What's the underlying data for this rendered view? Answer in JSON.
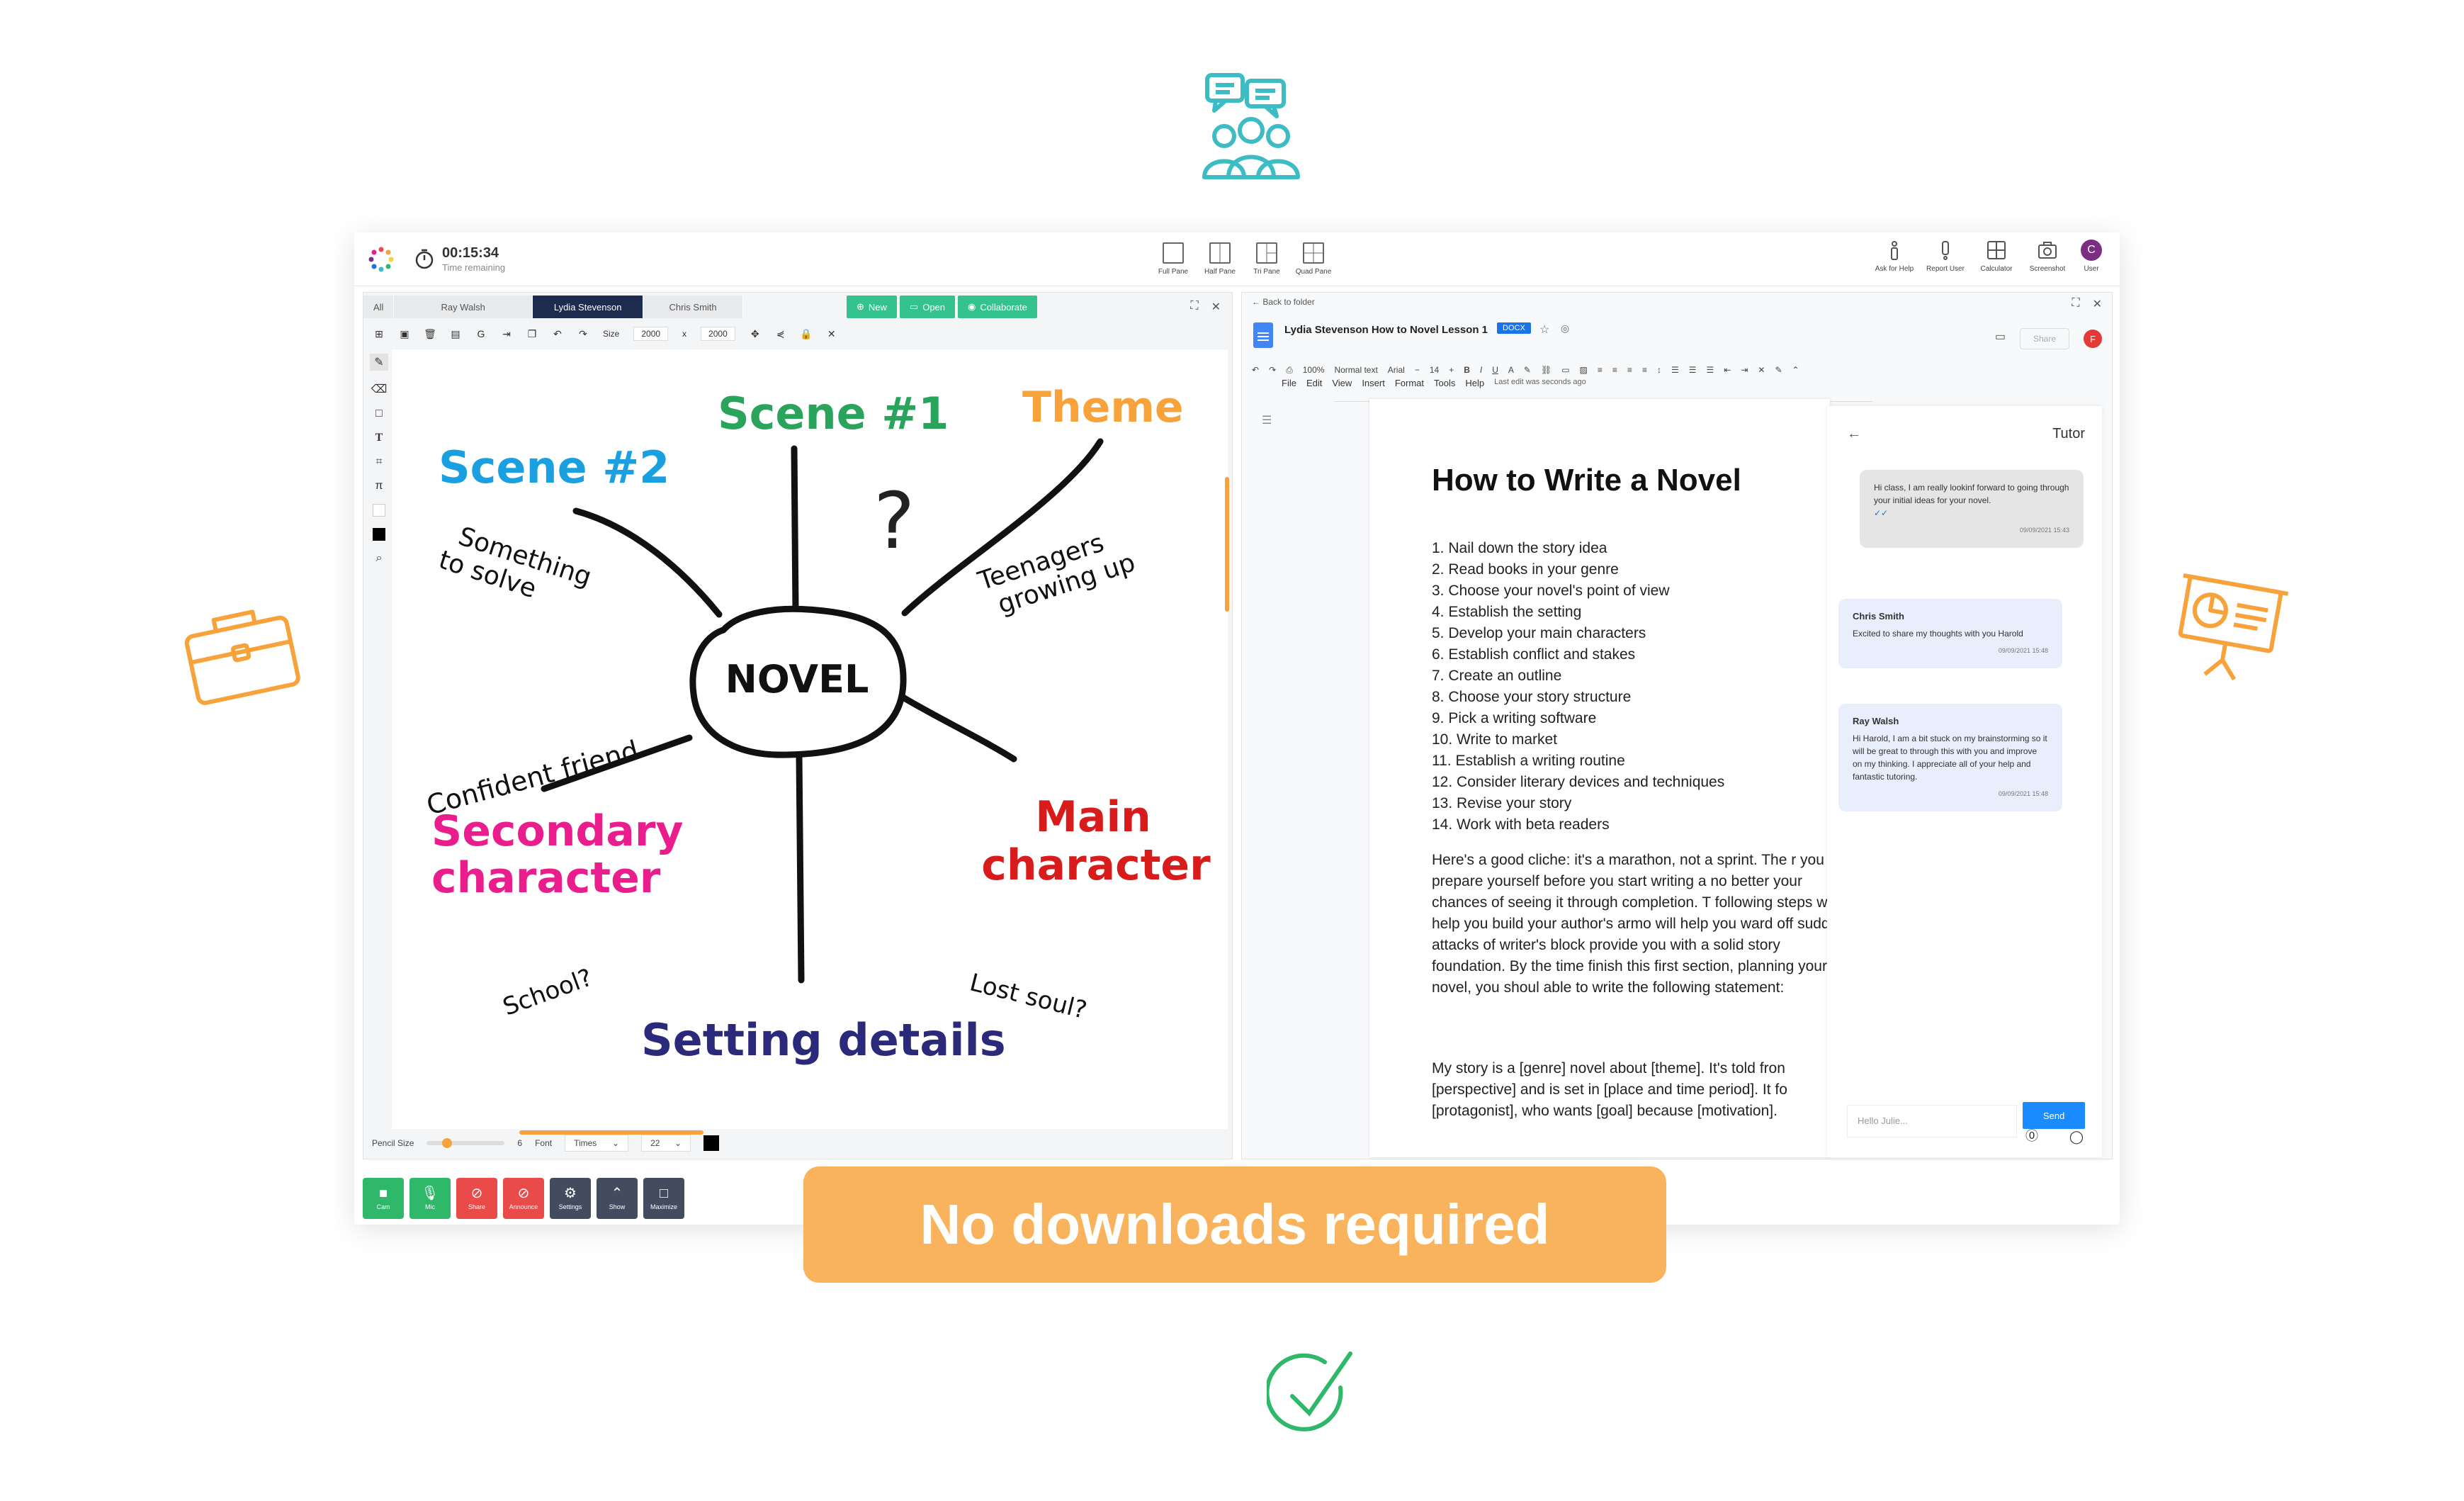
{
  "topbar": {
    "timer_value": "00:15:34",
    "timer_label": "Time remaining",
    "panes": [
      "Full Pane",
      "Half Pane",
      "Tri Pane",
      "Quad Pane"
    ],
    "tools": [
      "Ask for Help",
      "Report User",
      "Calculator",
      "Screenshot",
      "User"
    ],
    "avatar_letter": "C"
  },
  "whiteboard": {
    "tabs": [
      "All",
      "Ray Walsh",
      "Lydia Stevenson",
      "Chris Smith"
    ],
    "actions": [
      "New",
      "Open",
      "Collaborate"
    ],
    "size_label": "Size",
    "size_w": "2000",
    "size_x": "x",
    "size_h": "2000",
    "mindmap": {
      "center": "NOVEL",
      "scene1": "Scene #1",
      "scene2": "Scene #2",
      "theme": "Theme",
      "question": "?",
      "something": [
        "Something",
        "to solve"
      ],
      "teenagers": [
        "Teenagers",
        "growing up"
      ],
      "confident": "Confident friend",
      "secondary": [
        "Secondary",
        "character"
      ],
      "main": [
        "Main",
        "character"
      ],
      "school": "School?",
      "lostsoul": "Lost soul?",
      "setting": "Setting details"
    },
    "pencil_label": "Pencil Size",
    "pencil_value": "6",
    "font_label": "Font",
    "font_value": "Times",
    "font_size": "22"
  },
  "controls": [
    "Cam",
    "Mic",
    "Share",
    "Announce",
    "Settings",
    "Show",
    "Maximize"
  ],
  "doc": {
    "back": "Back to folder",
    "title": "Lydia Stevenson How to Novel Lesson 1",
    "badge": "DOCX",
    "menu": [
      "File",
      "Edit",
      "View",
      "Insert",
      "Format",
      "Tools",
      "Help"
    ],
    "last_edit": "Last edit was seconds ago",
    "zoom": "100%",
    "style": "Normal text",
    "font": "Arial",
    "font_size": "14",
    "share": "Share",
    "fav": "F",
    "heading": "How to Write a Novel",
    "list": [
      "1. Nail down the story idea",
      "2. Read books in your genre",
      "3. Choose your novel's point of view",
      "4. Establish the setting",
      "5. Develop your main characters",
      "6. Establish conflict and stakes",
      "7. Create an outline",
      "8. Choose your story structure",
      "9. Pick a writing software",
      "10. Write to market",
      "11. Establish a writing routine",
      "12. Consider literary devices and techniques",
      "13. Revise your story",
      "14. Work with beta readers"
    ],
    "para1": "Here's a good cliche: it's a marathon, not a sprint. The r you can prepare yourself before you start writing a no better your chances of seeing it through completion. T following steps will help you build your author's armo will help you ward off sudden attacks of writer's block provide you with a solid story foundation. By the time finish this first section, planning your novel, you shoul able to write the following statement:",
    "para2": "My story is a [genre] novel about [theme]. It's told fron [perspective] and is set in [place and time period]. It fo [protagonist], who wants [goal] because [motivation]."
  },
  "chat": {
    "title": "Tutor",
    "messages": [
      {
        "name": "",
        "text": "Hi class, I am really lookinf forward to going through your initial ideas for your novel.",
        "time": "09/09/2021 15:43"
      },
      {
        "name": "Chris Smith",
        "text": "Excited to share my thoughts with you Harold",
        "time": "09/09/2021 15:48"
      },
      {
        "name": "Ray Walsh",
        "text": "Hi Harold, I am a bit stuck on my brainstorming so it will be great to through this with you and improve on my thinking. I appreciate all of your help and fantastic tutoring.",
        "time": "09/09/2021 15:48"
      }
    ],
    "placeholder": "Hello Julie...",
    "send": "Send"
  },
  "banner": "No downloads required",
  "colors": {
    "green": "#2fb86a",
    "orange": "#f9b35d",
    "teal": "#3dbcc4",
    "navy": "#1d2b4f"
  }
}
